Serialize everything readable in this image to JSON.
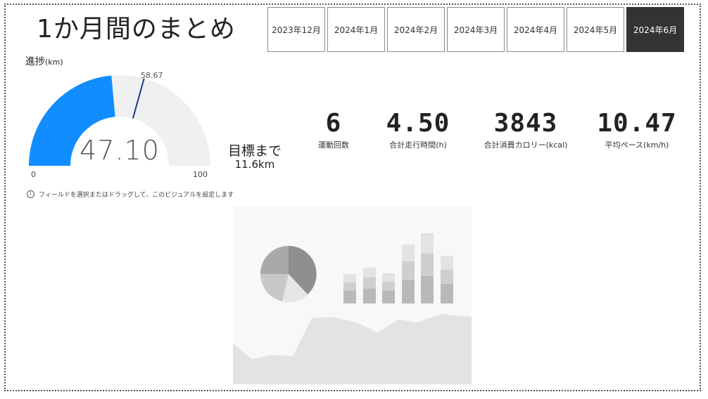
{
  "page_title": "1か月間のまとめ",
  "month_tabs": [
    {
      "label": "2023年12月",
      "active": false
    },
    {
      "label": "2024年1月",
      "active": false
    },
    {
      "label": "2024年2月",
      "active": false
    },
    {
      "label": "2024年3月",
      "active": false
    },
    {
      "label": "2024年4月",
      "active": false
    },
    {
      "label": "2024年5月",
      "active": false
    },
    {
      "label": "2024年6月",
      "active": true
    }
  ],
  "gauge": {
    "title": "進捗",
    "unit": "(km)",
    "value": 47.1,
    "value_label": "47.10",
    "min": 0,
    "min_label": "0",
    "max": 100,
    "max_label": "100",
    "target": 58.67,
    "target_label": "58.67",
    "fill_color": "#118DFF",
    "track_color": "#F0F0F0",
    "target_color": "#1F3A8A"
  },
  "remaining": {
    "label": "目標まで",
    "value": "11.6km"
  },
  "kpis": [
    {
      "value": "6",
      "label": "運動回数"
    },
    {
      "value": "4.50",
      "label": "合計走行時間(h)"
    },
    {
      "value": "3843",
      "label": "合計消費カロリー(kcal)"
    },
    {
      "value": "10.47",
      "label": "平均ペース(km/h)"
    }
  ],
  "hint": {
    "icon": "info-icon",
    "text": "フィールドを選択またはドラッグして、このビジュアルを設定します"
  }
}
